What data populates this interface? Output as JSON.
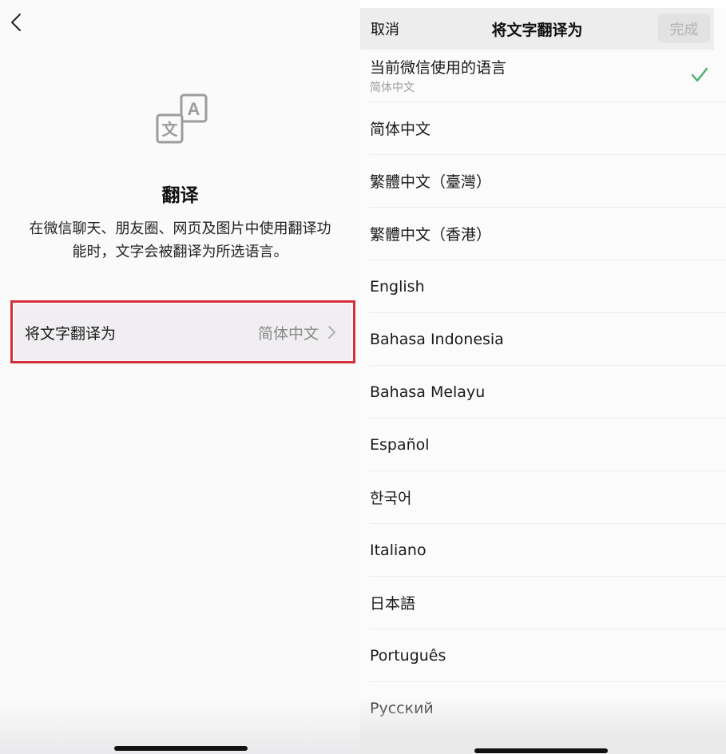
{
  "left": {
    "title": "翻译",
    "description": "在微信聊天、朋友圈、网页及图片中使用翻译功能时，文字会被翻译为所选语言。",
    "setting_label": "将文字翻译为",
    "setting_value": "简体中文",
    "icon_letters": {
      "a": "A",
      "wen": "文"
    }
  },
  "right": {
    "header": {
      "cancel": "取消",
      "title": "将文字翻译为",
      "done": "完成"
    },
    "current": {
      "label": "当前微信使用的语言",
      "sub": "简体中文",
      "selected": true
    },
    "languages": [
      "简体中文",
      "繁體中文（臺灣）",
      "繁體中文（香港）",
      "English",
      "Bahasa Indonesia",
      "Bahasa Melayu",
      "Español",
      "한국어",
      "Italiano",
      "日本語",
      "Português",
      "Русский"
    ]
  },
  "colors": {
    "check": "#4caf6a",
    "highlight": "#d32f3a"
  }
}
